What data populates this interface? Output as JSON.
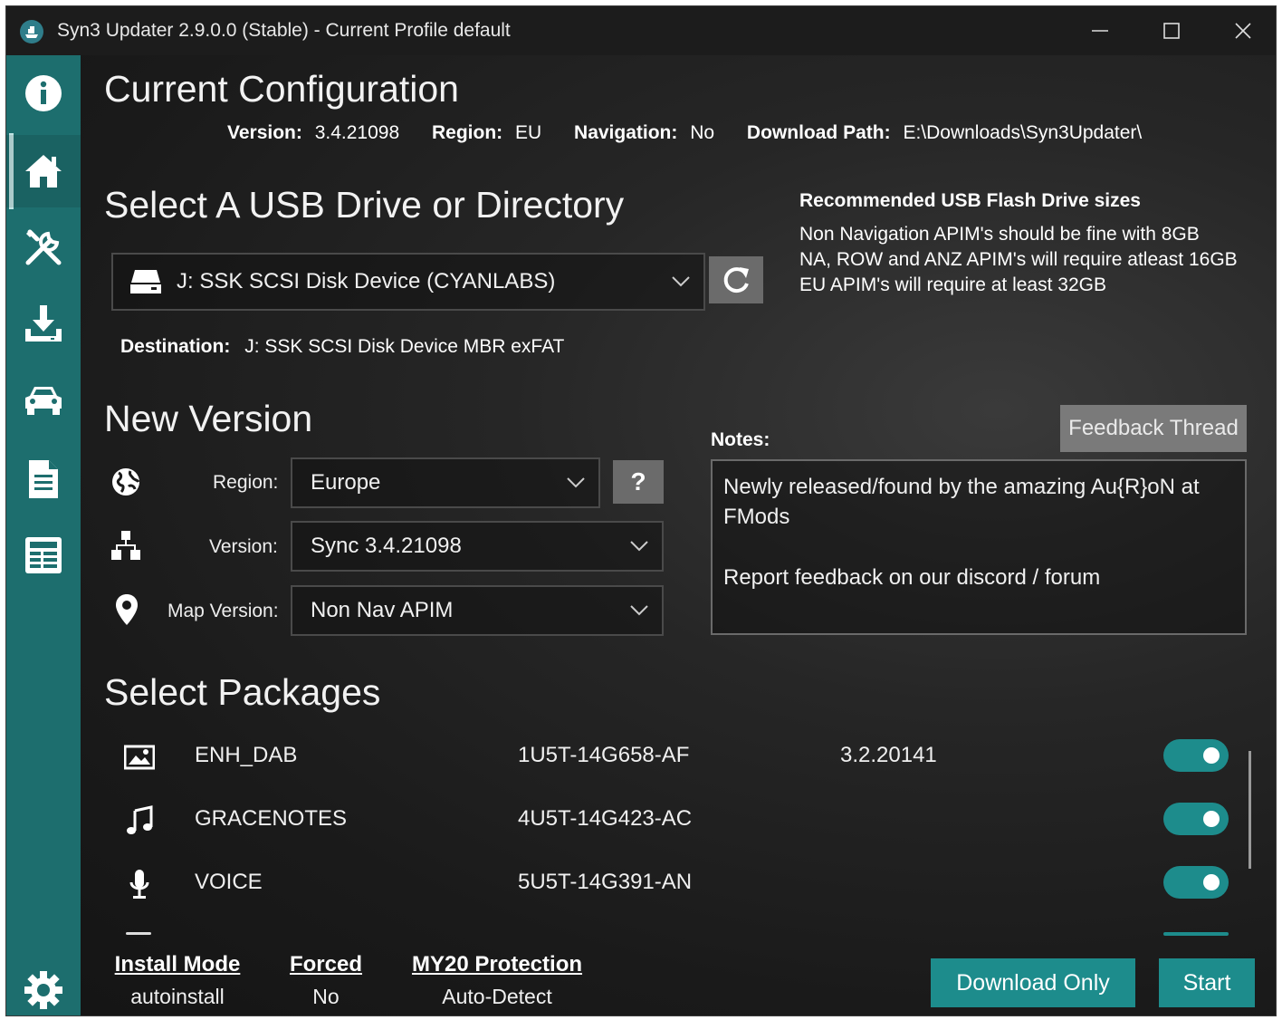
{
  "window": {
    "title": "Syn3 Updater 2.9.0.0 (Stable) - Current Profile default"
  },
  "sidebar": {
    "items": [
      {
        "icon": "info-icon"
      },
      {
        "icon": "home-icon"
      },
      {
        "icon": "tools-icon"
      },
      {
        "icon": "download-icon"
      },
      {
        "icon": "car-icon"
      },
      {
        "icon": "document-icon"
      },
      {
        "icon": "logs-icon"
      },
      {
        "icon": "settings-icon"
      }
    ],
    "active_index": 1
  },
  "current_config": {
    "heading": "Current Configuration",
    "version_label": "Version:",
    "version_value": "3.4.21098",
    "region_label": "Region:",
    "region_value": "EU",
    "navigation_label": "Navigation:",
    "navigation_value": "No",
    "download_path_label": "Download Path:",
    "download_path_value": "E:\\Downloads\\Syn3Updater\\"
  },
  "usb": {
    "heading": "Select A USB Drive or Directory",
    "selected_drive": "J:  SSK  SCSI Disk Device  (CYANLABS)",
    "destination_label": "Destination:",
    "destination_value": "J:  SSK  SCSI Disk Device  MBR exFAT"
  },
  "recommended": {
    "title": "Recommended USB Flash Drive sizes",
    "line1": "Non Navigation APIM's should be fine with 8GB",
    "line2": "NA, ROW and ANZ APIM's will require atleast 16GB",
    "line3": "EU APIM's will require at least 32GB"
  },
  "new_version": {
    "heading": "New Version",
    "region_label": "Region:",
    "region_value": "Europe",
    "help_label": "?",
    "version_label": "Version:",
    "version_value": "Sync 3.4.21098",
    "map_label": "Map Version:",
    "map_value": "Non Nav APIM"
  },
  "notes": {
    "label": "Notes:",
    "feedback_button": "Feedback Thread",
    "line1": "Newly released/found by the amazing Au{R}oN at",
    "line2": "FMods",
    "line3": "Report feedback on our discord / forum"
  },
  "packages": {
    "heading": "Select Packages",
    "rows": [
      {
        "icon": "image-icon",
        "name": "ENH_DAB",
        "part": "1U5T-14G658-AF",
        "version": "3.2.20141",
        "enabled": true
      },
      {
        "icon": "music-icon",
        "name": "GRACENOTES",
        "part": "4U5T-14G423-AC",
        "version": "",
        "enabled": true
      },
      {
        "icon": "microphone-icon",
        "name": "VOICE",
        "part": "5U5T-14G391-AN",
        "version": "",
        "enabled": true
      }
    ]
  },
  "footer": {
    "install_mode_label": "Install Mode",
    "install_mode_value": "autoinstall",
    "forced_label": "Forced",
    "forced_value": "No",
    "my20_label": "MY20 Protection",
    "my20_value": "Auto-Detect",
    "download_only_label": "Download Only",
    "start_label": "Start"
  },
  "colors": {
    "accent": "#1d8c8c",
    "sidebar": "#1d6e6e",
    "background": "#1a1a1a",
    "button_gray": "#6b6b6b"
  }
}
